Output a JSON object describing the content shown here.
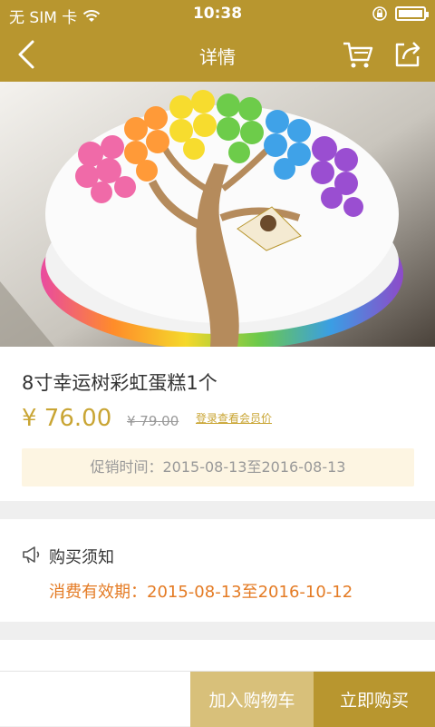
{
  "status_bar": {
    "carrier": "无 SIM 卡",
    "time": "10:38",
    "icons": [
      "wifi-icon",
      "rotation-lock-icon",
      "battery-icon"
    ]
  },
  "nav": {
    "title": "详情",
    "icons": [
      "back-arrow-icon",
      "cart-icon",
      "share-icon"
    ]
  },
  "product": {
    "name": "8寸幸运树彩虹蛋糕1个",
    "price": "¥ 76.00",
    "original_price": "¥ 79.00",
    "member_link": "登录查看会员价",
    "promo": "促销时间：2015-08-13至2016-08-13",
    "image": "rainbow-tree-cake-photo"
  },
  "notice": {
    "title": "购买须知",
    "validity": "消费有效期：2015-08-13至2016-10-12",
    "icon": "megaphone-icon"
  },
  "actions": {
    "add_to_cart": "加入购物车",
    "buy_now": "立即购买"
  },
  "colors": {
    "brand_gold": "#b8962f",
    "light_gold": "#d8c07a",
    "price_gold": "#c9a534",
    "notice_orange": "#e47b24",
    "promo_bg": "#fdf5e2"
  }
}
